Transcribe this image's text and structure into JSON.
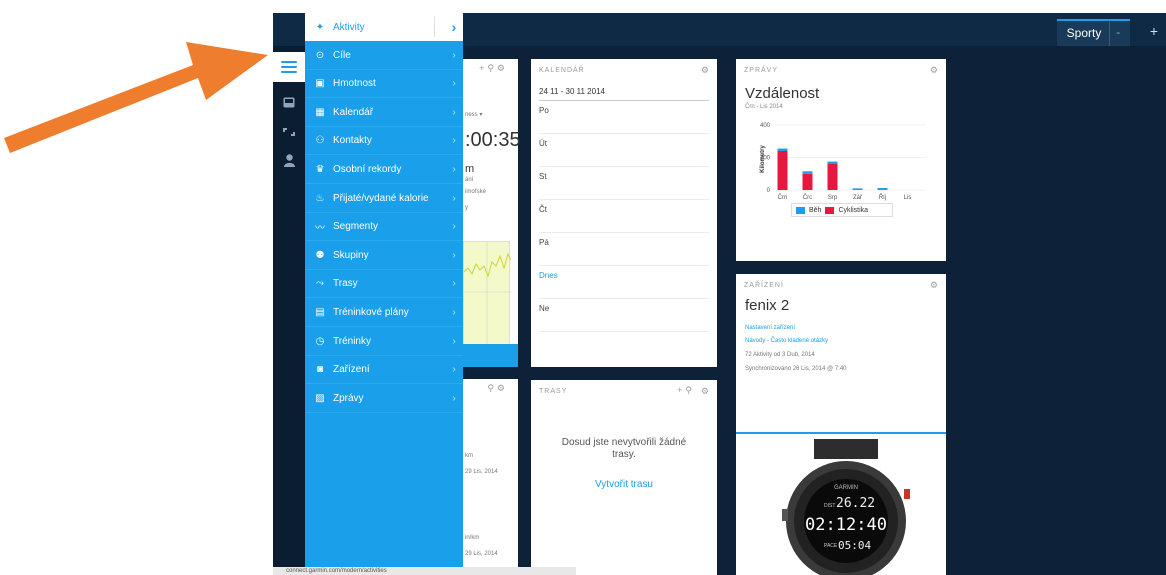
{
  "app": {
    "tabs": [
      {
        "label": "Sporty",
        "sep": "-"
      }
    ],
    "add_tab": "+"
  },
  "menu": {
    "items": [
      {
        "label": "Aktivity",
        "icon": "person-running-icon",
        "glyph": "✦"
      },
      {
        "label": "Cíle",
        "icon": "target-icon",
        "glyph": "⊙"
      },
      {
        "label": "Hmotnost",
        "icon": "scale-icon",
        "glyph": "▣"
      },
      {
        "label": "Kalendář",
        "icon": "calendar-icon",
        "glyph": "▦"
      },
      {
        "label": "Kontakty",
        "icon": "contacts-icon",
        "glyph": "⚇"
      },
      {
        "label": "Osobní rekordy",
        "icon": "trophy-icon",
        "glyph": "♛"
      },
      {
        "label": "Přijaté/vydané kalorie",
        "icon": "flame-icon",
        "glyph": "♨"
      },
      {
        "label": "Segmenty",
        "icon": "segments-icon",
        "glyph": "〰"
      },
      {
        "label": "Skupiny",
        "icon": "groups-icon",
        "glyph": "⚉"
      },
      {
        "label": "Trasy",
        "icon": "routes-icon",
        "glyph": "⤳"
      },
      {
        "label": "Tréninkové plány",
        "icon": "plan-icon",
        "glyph": "▤"
      },
      {
        "label": "Tréninky",
        "icon": "stopwatch-icon",
        "glyph": "◷"
      },
      {
        "label": "Zařízení",
        "icon": "device-icon",
        "glyph": "◙"
      },
      {
        "label": "Zprávy",
        "icon": "reports-icon",
        "glyph": "▨"
      }
    ]
  },
  "partial_card": {
    "line1": "ness ▾",
    "time": ":00:35",
    "line2": "m",
    "line3": "ání",
    "line4": "imořské",
    "line5": "y"
  },
  "partial_card2": {
    "l1": "km",
    "l2": "29 Lis, 2014",
    "l3": "in/km",
    "l4": "29 Lis, 2014"
  },
  "calendar": {
    "title": "KALENDÁŘ",
    "range": "24 11 - 30 11 2014",
    "days": [
      "Po",
      "Út",
      "St",
      "Čt",
      "Pá",
      "Dnes",
      "Ne"
    ]
  },
  "routes": {
    "title": "TRASY",
    "empty_text": "Dosud jste nevytvořili žádné trasy.",
    "create_link": "Vytvořit trasu"
  },
  "reports": {
    "title": "ZPRÁVY",
    "heading": "Vzdálenost",
    "subheading": "Črn - Lis 2014"
  },
  "chart_data": {
    "type": "bar",
    "categories": [
      "Črn",
      "Črc",
      "Srp",
      "Zář",
      "Říj",
      "Lis"
    ],
    "series": [
      {
        "name": "Běh",
        "color": "#1e9ee8",
        "values": [
          15,
          15,
          15,
          10,
          12,
          0
        ]
      },
      {
        "name": "Cyklistika",
        "color": "#e8173f",
        "values": [
          240,
          100,
          160,
          0,
          0,
          0
        ]
      }
    ],
    "stacked": true,
    "ylabel": "Kilometry",
    "yticks": [
      0,
      200,
      400
    ],
    "ylim": [
      0,
      400
    ],
    "legend": "bottom"
  },
  "device": {
    "title": "ZAŘÍZENÍ",
    "name": "fenix 2",
    "link1": "Nastavení zařízení",
    "link2": "Návody - Často kladené otázky",
    "info1": "72 Aktivity od 3 Dub, 2014",
    "info2": "Synchronizováno 26 Lis, 2014 @ 7:40",
    "watch_brand": "GARMIN",
    "watch_dist": "26.22",
    "watch_time": "02:12:40",
    "watch_pace": "05:04",
    "watch_dist_label": "DIST",
    "watch_pace_label": "PACE"
  },
  "status": {
    "url": "connect.garmin.com/modern/activities"
  },
  "colors": {
    "accent": "#1e9ee8",
    "arrow": "#ef7d2e",
    "cycling": "#e8173f"
  }
}
